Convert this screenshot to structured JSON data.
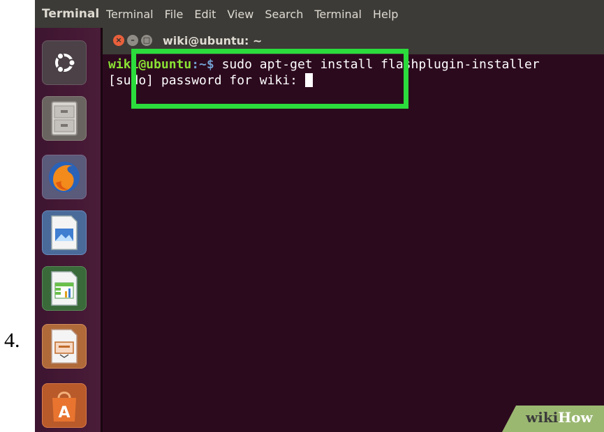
{
  "step_number": "4.",
  "top_panel": {
    "app_name": "Terminal",
    "menu": [
      "Terminal",
      "File",
      "Edit",
      "View",
      "Search",
      "Terminal",
      "Help"
    ]
  },
  "launcher": {
    "items": [
      "ubuntu-dash-icon",
      "files-cabinet-icon",
      "firefox-icon",
      "libreoffice-impress-icon",
      "libreoffice-calc-icon",
      "libreoffice-present-icon",
      "software-center-icon"
    ]
  },
  "terminal": {
    "title": "wiki@ubuntu: ~",
    "prompt_user": "wiki@ubuntu",
    "prompt_path": ":~$",
    "command": " sudo apt-get install flashplugin-installer",
    "password_prompt": "[sudo] password for wiki: "
  },
  "watermark": {
    "wiki": "wiki",
    "how": "How"
  },
  "colors": {
    "terminal_bg": "#2c0a1e",
    "panel_bg": "#3c3b37",
    "highlight": "#2bdc3c",
    "close_button": "#e8603c"
  }
}
